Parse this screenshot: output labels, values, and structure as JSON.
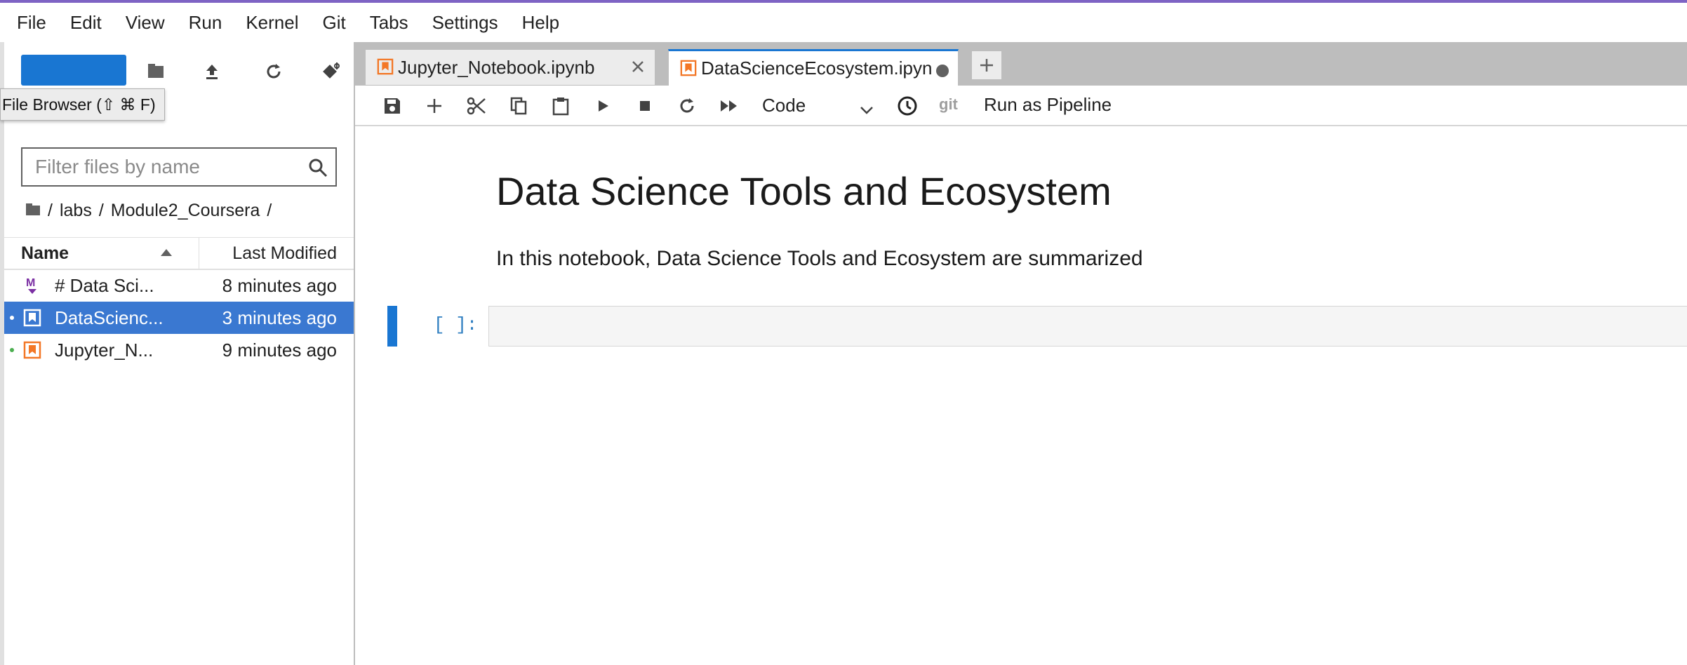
{
  "menubar": {
    "items": [
      "File",
      "Edit",
      "View",
      "Run",
      "Kernel",
      "Git",
      "Tabs",
      "Settings",
      "Help"
    ]
  },
  "sidebar": {
    "tooltip": "File Browser (⇧ ⌘ F)",
    "filter_placeholder": "Filter files by name",
    "breadcrumbs": [
      "labs",
      "Module2_Coursera"
    ],
    "header": {
      "name": "Name",
      "modified": "Last Modified"
    },
    "files": [
      {
        "name": "# Data Sci...",
        "modified": "8 minutes ago",
        "icon": "markdown-icon",
        "selected": false,
        "running": false
      },
      {
        "name": "DataScienc...",
        "modified": "3 minutes ago",
        "icon": "notebook-icon",
        "selected": true,
        "running": true
      },
      {
        "name": "Jupyter_N...",
        "modified": "9 minutes ago",
        "icon": "notebook-icon",
        "selected": false,
        "running": true
      }
    ]
  },
  "tabs": [
    {
      "label": "Jupyter_Notebook.ipynb",
      "active": false
    },
    {
      "label": "DataScienceEcosystem.ipyn",
      "active": true
    }
  ],
  "toolbar": {
    "cell_type": "Code",
    "git_label": "git",
    "pipeline_label": "Run as Pipeline"
  },
  "notebook": {
    "heading": "Data Science Tools and Ecosystem",
    "paragraph": "In this notebook, Data Science Tools and Ecosystem are summarized",
    "prompt": "[ ]:"
  },
  "colors": {
    "accent": "#1976d2",
    "selection": "#3a78d1",
    "notebook_orange": "#f37726",
    "markdown_purple": "#7b2fa3",
    "running_green": "#4caf50"
  }
}
